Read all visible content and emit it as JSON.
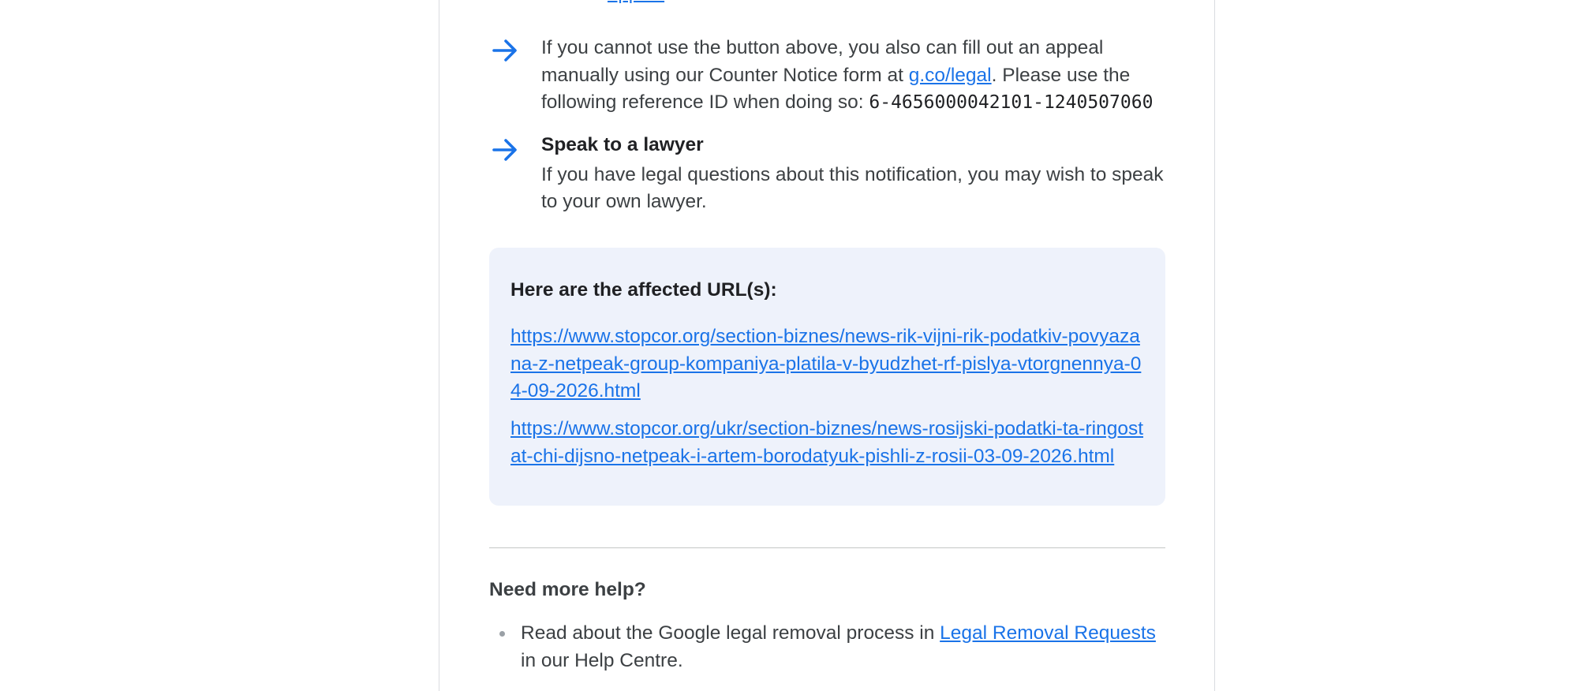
{
  "top_partial_link": "appeal",
  "steps": [
    {
      "icon": "arrow-right-icon",
      "text_before": "If you cannot use the button above, you also can fill out an appeal manually using our Counter Notice form at ",
      "link": "g.co/legal",
      "text_after": ". Please use the following reference ID when doing so: ",
      "reference_id": "6-4656000042101-1240507060"
    },
    {
      "icon": "arrow-right-icon",
      "title": "Speak to a lawyer",
      "text": "If you have legal questions about this notification, you may wish to speak to your own lawyer."
    }
  ],
  "affected": {
    "heading": "Here are the affected URL(s):",
    "urls": [
      "https://www.stopcor.org/section-biznes/news-rik-vijni-rik-podatkiv-povyazana-z-netpeak-group-kompaniya-platila-v-byudzhet-rf-pislya-vtorgnennya-04-09-2026.html",
      "https://www.stopcor.org/ukr/section-biznes/news-rosijski-podatki-ta-ringostat-chi-dijsno-netpeak-i-artem-borodatyuk-pishli-z-rosii-03-09-2026.html"
    ]
  },
  "help": {
    "heading": "Need more help?",
    "text_before": "Read about the Google legal removal process in ",
    "link": "Legal Removal Requests",
    "text_after": " in our Help Centre."
  },
  "colors": {
    "accent": "#1a73e8",
    "url_box_bg": "#eef2fb",
    "divider": "#c4c7c5"
  }
}
